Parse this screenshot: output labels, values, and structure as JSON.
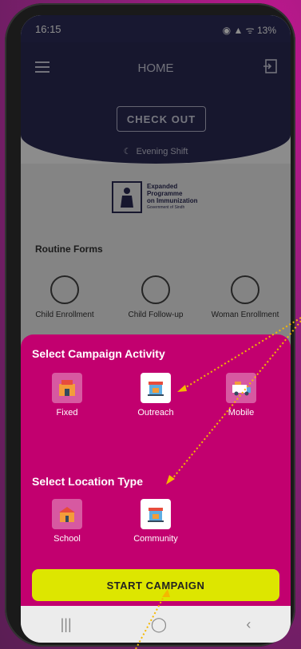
{
  "status_bar": {
    "time": "16:15",
    "battery": "13%"
  },
  "header": {
    "title": "HOME",
    "checkout_label": "CHECK OUT",
    "shift": "Evening Shift"
  },
  "logo": {
    "line1": "Expanded",
    "line2": "Programme",
    "line3": "on Immunization",
    "line4": "Government of Sindh"
  },
  "routine": {
    "title": "Routine Forms",
    "items": [
      "Child Enrollment",
      "Child Follow-up",
      "Woman Enrollment"
    ]
  },
  "sheet": {
    "activity_title": "Select Campaign Activity",
    "activities": [
      {
        "label": "Fixed",
        "selected": false
      },
      {
        "label": "Outreach",
        "selected": true
      },
      {
        "label": "Mobile",
        "selected": false
      }
    ],
    "location_title": "Select Location Type",
    "locations": [
      {
        "label": "School",
        "selected": false
      },
      {
        "label": "Community",
        "selected": true
      }
    ],
    "start_label": "START CAMPAIGN"
  },
  "colors": {
    "accent": "#c2006f",
    "header": "#2b2a55",
    "button": "#dde600",
    "arrow": "#f5b800"
  }
}
